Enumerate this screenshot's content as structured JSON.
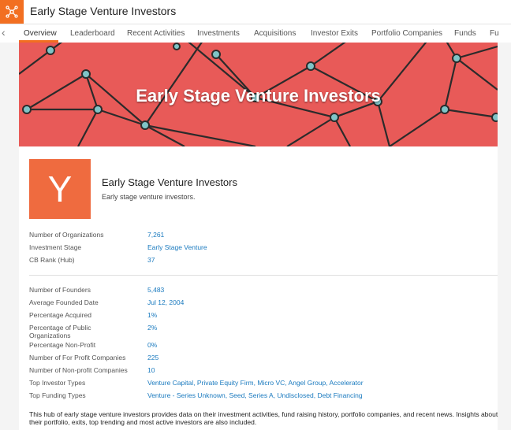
{
  "app": {
    "title": "Early Stage Venture Investors"
  },
  "tabs": [
    {
      "label": "Overview"
    },
    {
      "label": "Leaderboard"
    },
    {
      "label": "Recent Activities"
    },
    {
      "label": "Investments"
    },
    {
      "label": "Acquisitions"
    },
    {
      "label": "Investor Exits"
    },
    {
      "label": "Portfolio Companies"
    },
    {
      "label": "Funds"
    },
    {
      "label": "Fu"
    }
  ],
  "hero": {
    "title": "Early Stage Venture Investors"
  },
  "profile": {
    "logo_letter": "Y",
    "name": "Early Stage Venture Investors",
    "description": "Early stage venture investors."
  },
  "overview": [
    {
      "label": "Number of Organizations",
      "value": "7,261"
    },
    {
      "label": "Investment Stage",
      "value": "Early Stage Venture"
    },
    {
      "label": "CB Rank (Hub)",
      "value": "37"
    }
  ],
  "stats": [
    {
      "label": "Number of Founders",
      "value": "5,483"
    },
    {
      "label": "Average Founded Date",
      "value": "Jul 12, 2004"
    },
    {
      "label": "Percentage Acquired",
      "value": "1%"
    },
    {
      "label": "Percentage of Public Organizations",
      "value": "2%"
    },
    {
      "label": "Percentage Non-Profit",
      "value": "0%"
    },
    {
      "label": "Number of For Profit Companies",
      "value": "225"
    },
    {
      "label": "Number of Non-profit Companies",
      "value": "10"
    },
    {
      "label": "Top Investor Types",
      "value": "Venture Capital, Private Equity Firm, Micro VC, Angel Group, Accelerator"
    },
    {
      "label": "Top Funding Types",
      "value": "Venture - Series Unknown, Seed, Series A, Undisclosed, Debt Financing"
    }
  ],
  "footer_text": "This hub of early stage venture investors provides data on their investment activities, fund raising history, portfolio companies, and recent news. Insights about their portfolio, exits, top trending and most active investors are also included.",
  "colors": {
    "accent": "#f26f21",
    "hero": "#e85a58",
    "link": "#1a7abf"
  }
}
